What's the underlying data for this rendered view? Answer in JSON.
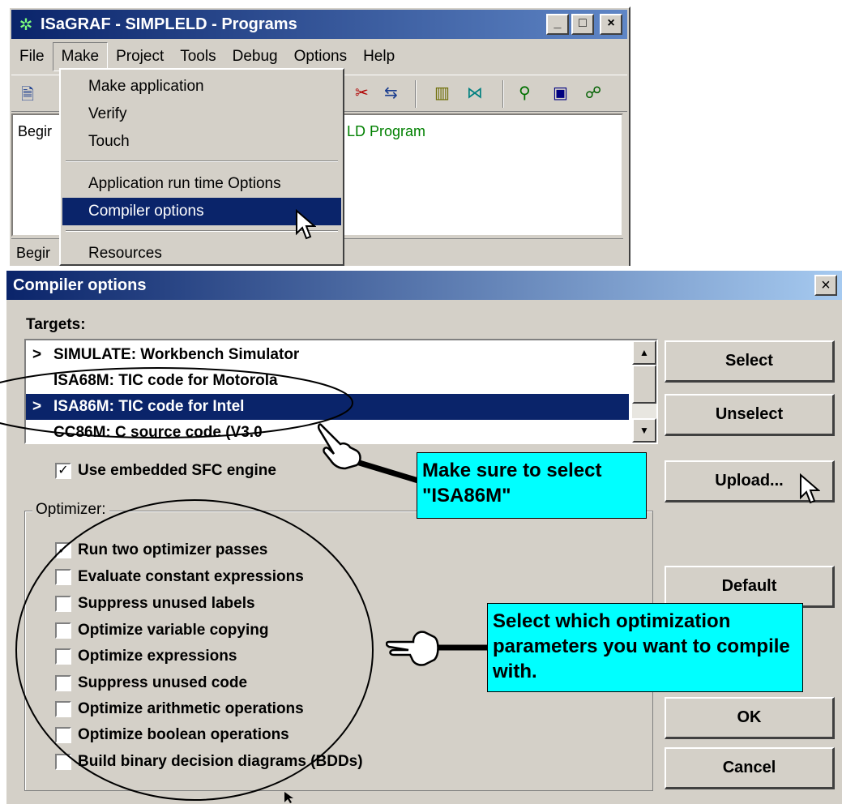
{
  "window": {
    "title": "ISaGRAF - SIMPLELD - Programs",
    "buttons": [
      "_",
      "□",
      "×"
    ]
  },
  "menubar": [
    "File",
    "Make",
    "Project",
    "Tools",
    "Debug",
    "Options",
    "Help"
  ],
  "list": {
    "row_prefix": "Begir",
    "row_program": "LD Program",
    "status_prefix": "Begir"
  },
  "make_menu": {
    "items": [
      "Make application",
      "Verify",
      "Touch",
      "Application run time Options",
      "Compiler options",
      "Resources"
    ],
    "selected": "Compiler options"
  },
  "dialog": {
    "title": "Compiler options",
    "close": "×",
    "targets_label": "Targets:",
    "targets": [
      {
        "mark": ">",
        "text": "SIMULATE: Workbench Simulator"
      },
      {
        "mark": "",
        "text": "ISA68M: TIC code for Motorola"
      },
      {
        "mark": ">",
        "text": "ISA86M: TIC code for Intel"
      },
      {
        "mark": "",
        "text": "CC86M: C source code (V3.0"
      }
    ],
    "selected_target": "ISA86M: TIC code for Intel",
    "embedded_sfc": {
      "label": "Use embedded SFC engine",
      "checked": true
    },
    "optimizer_label": "Optimizer:",
    "optimizer_options": [
      {
        "label": "Run two optimizer passes",
        "checked": true
      },
      {
        "label": "Evaluate constant expressions",
        "checked": false
      },
      {
        "label": "Suppress unused labels",
        "checked": false
      },
      {
        "label": "Optimize variable copying",
        "checked": false
      },
      {
        "label": "Optimize expressions",
        "checked": false
      },
      {
        "label": "Suppress unused code",
        "checked": false
      },
      {
        "label": "Optimize arithmetic operations",
        "checked": false
      },
      {
        "label": "Optimize boolean operations",
        "checked": false
      },
      {
        "label": "Build binary decision diagrams (BDDs)",
        "checked": false
      }
    ],
    "buttons": {
      "select": "Select",
      "unselect": "Unselect",
      "upload": "Upload...",
      "default": "Default",
      "ok": "OK",
      "cancel": "Cancel"
    }
  },
  "annotations": {
    "callout1": "Make sure to select \"ISA86M\"",
    "callout2": "Select which optimization parameters you want to compile with."
  },
  "colors": {
    "title_active": "#0a246a",
    "face": "#d4d0c8",
    "callout_bg": "#00ffff",
    "link_green": "#008000"
  }
}
